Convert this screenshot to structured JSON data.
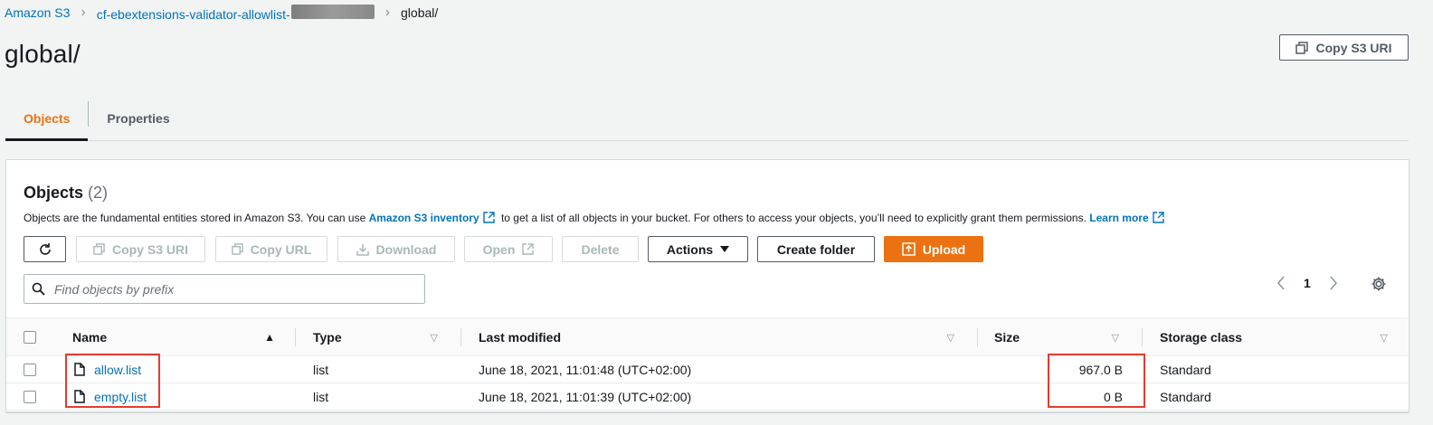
{
  "breadcrumb": {
    "root": "Amazon S3",
    "bucket": "cf-ebextensions-validator-allowlist-",
    "current": "global/"
  },
  "page": {
    "title": "global/",
    "copy_s3_uri": "Copy S3 URI"
  },
  "tabs": [
    {
      "label": "Objects",
      "active": true
    },
    {
      "label": "Properties",
      "active": false
    }
  ],
  "objects_panel": {
    "title": "Objects",
    "count": "(2)",
    "description_1": "Objects are the fundamental entities stored in Amazon S3. You can use",
    "inventory_link": "Amazon S3 inventory",
    "description_2": "to get a list of all objects in your bucket. For others to access your objects, you’ll need to explicitly grant them permissions.",
    "learn_more": "Learn more"
  },
  "toolbar": {
    "refresh_icon": "refresh-icon",
    "copy_s3_uri": "Copy S3 URI",
    "copy_url": "Copy URL",
    "download": "Download",
    "open": "Open",
    "delete": "Delete",
    "actions": "Actions",
    "create_folder": "Create folder",
    "upload": "Upload"
  },
  "search": {
    "placeholder": "Find objects by prefix",
    "value": ""
  },
  "pagination": {
    "current_page": "1"
  },
  "table": {
    "columns": [
      "Name",
      "Type",
      "Last modified",
      "Size",
      "Storage class"
    ],
    "rows": [
      {
        "name": "allow.list",
        "type": "list",
        "last_modified": "June 18, 2021, 11:01:48 (UTC+02:00)",
        "size": "967.0 B",
        "storage_class": "Standard"
      },
      {
        "name": "empty.list",
        "type": "list",
        "last_modified": "June 18, 2021, 11:01:39 (UTC+02:00)",
        "size": "0 B",
        "storage_class": "Standard"
      }
    ]
  },
  "colors": {
    "accent": "#ec7211",
    "link": "#0073bb",
    "highlight": "#e53b2f"
  }
}
